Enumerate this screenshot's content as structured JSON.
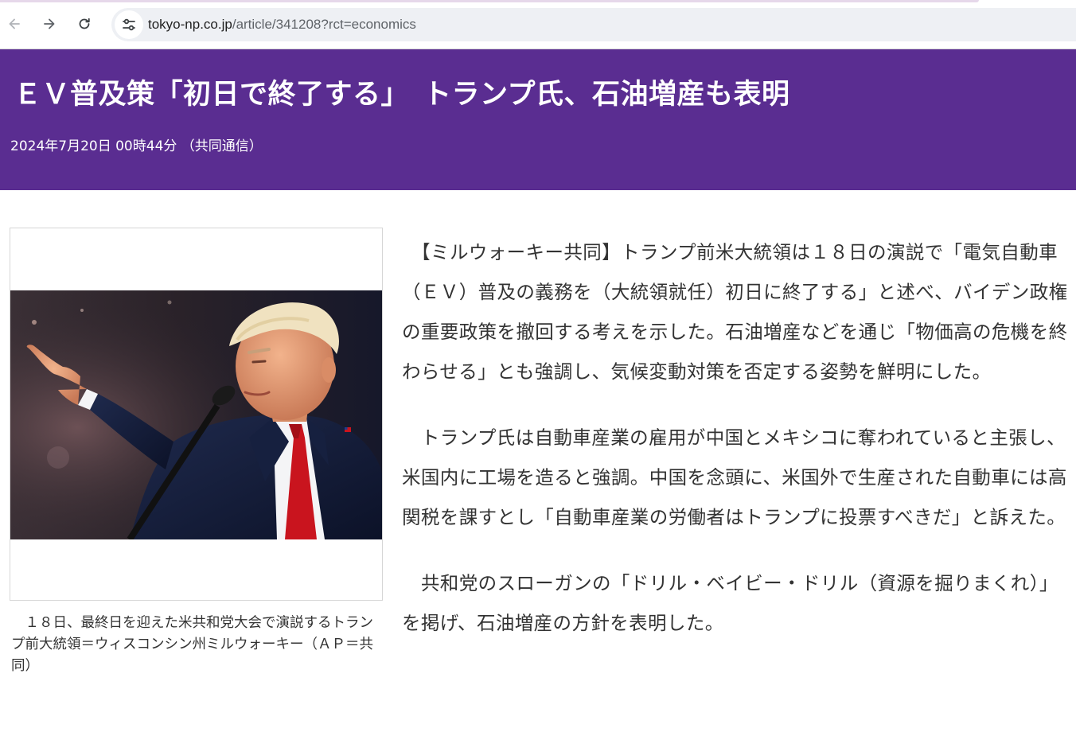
{
  "browser": {
    "url_host": "tokyo-np.co.jp",
    "url_path": "/article/341208?rct=economics",
    "back_icon": "arrow-left-icon",
    "forward_icon": "arrow-right-icon",
    "reload_icon": "reload-icon",
    "site_info_icon": "tune-icon"
  },
  "article": {
    "headline": "ＥＶ普及策「初日で終了する」　トランプ氏、石油増産も表明",
    "dateline": "2024年7月20日 00時44分 （共同通信）",
    "caption": "　１８日、最終日を迎えた米共和党大会で演説するトランプ前大統領＝ウィスコンシン州ミルウォーキー（ＡＰ＝共同）",
    "paragraphs": [
      "　【ミルウォーキー共同】トランプ前米大統領は１８日の演説で「電気自動車（ＥＶ）普及の義務を（大統領就任）初日に終了する」と述べ、バイデン政権の重要政策を撤回する考えを示した。石油増産などを通じ「物価高の危機を終わらせる」とも強調し、気候変動対策を否定する姿勢を鮮明にした。",
      "　トランプ氏は自動車産業の雇用が中国とメキシコに奪われていると主張し、米国内に工場を造ると強調。中国を念頭に、米国外で生産された自動車には高関税を課すとし「自動車産業の労働者はトランプに投票すべきだ」と訴えた。",
      "　共和党のスローガンの「ドリル・ベイビー・ドリル（資源を掘りまくれ）」を掲げ、石油増産の方針を表明した。"
    ]
  },
  "colors": {
    "header_bg": "#5a2d91",
    "header_text": "#ffffff",
    "body_text": "#333333"
  }
}
